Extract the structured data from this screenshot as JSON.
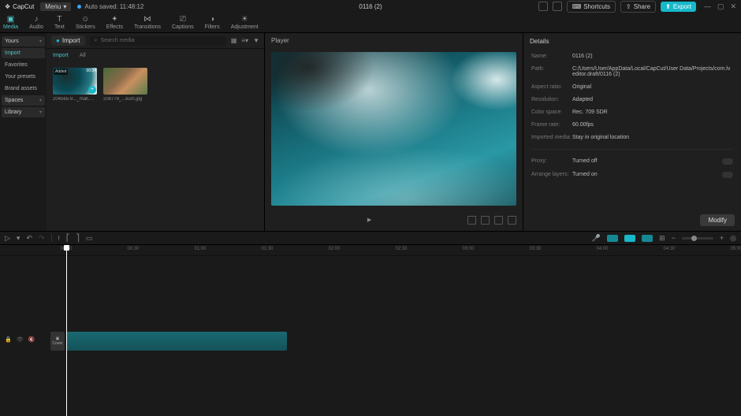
{
  "app": {
    "name": "CapCut",
    "menu_label": "Menu",
    "autosave": "Auto saved: 11:48:12",
    "project_title": "0116 (2)"
  },
  "top_buttons": {
    "shortcuts": "Shortcuts",
    "share": "Share",
    "export": "Export"
  },
  "tabs": [
    "Media",
    "Audio",
    "Text",
    "Stickers",
    "Effects",
    "Transitions",
    "Captions",
    "Filters",
    "Adjustment"
  ],
  "left_panel": {
    "items": [
      {
        "label": "Yours",
        "kind": "badge"
      },
      {
        "label": "Import",
        "kind": "active"
      },
      {
        "label": "Favorites"
      },
      {
        "label": "Your presets"
      },
      {
        "label": "Brand assets"
      },
      {
        "label": "Spaces",
        "kind": "expand"
      },
      {
        "label": "Library",
        "kind": "expand"
      }
    ]
  },
  "import": {
    "button": "Import",
    "search_placeholder": "Search media",
    "subtabs": [
      "Import",
      "All"
    ]
  },
  "thumbs": [
    {
      "name": "204565-9..._mall.mp4",
      "badge": "Added",
      "duration": "00:34",
      "style": "ocean"
    },
    {
      "name": "208779_...kum.jpg",
      "style": "people"
    }
  ],
  "player": {
    "title": "Player",
    "timecode_left": "",
    "timecode_right": ""
  },
  "details": {
    "title": "Details",
    "rows": [
      {
        "label": "Name:",
        "value": "0116 (2)"
      },
      {
        "label": "Path:",
        "value": "C:/Users/User/AppData/Local/CapCut/User Data/Projects/com.lveditor.draft/0116 (2)"
      },
      {
        "label": "Aspect ratio:",
        "value": "Original"
      },
      {
        "label": "Resolution:",
        "value": "Adapted"
      },
      {
        "label": "Color space:",
        "value": "Rec. 709 SDR"
      },
      {
        "label": "Frame rate:",
        "value": "60.00fps"
      },
      {
        "label": "Imported media:",
        "value": "Stay in original location"
      }
    ],
    "toggles": [
      {
        "label": "Proxy:",
        "value": "Turned off"
      },
      {
        "label": "Arrange layers:",
        "value": "Turned on"
      }
    ],
    "modify": "Modify"
  },
  "timeline": {
    "cover_label": "Cover",
    "ruler": [
      "00:00",
      "00:30",
      "01:00",
      "01:30",
      "02:00",
      "02:30",
      "03:00",
      "03:30",
      "04:00",
      "04:30",
      "05:00"
    ]
  }
}
